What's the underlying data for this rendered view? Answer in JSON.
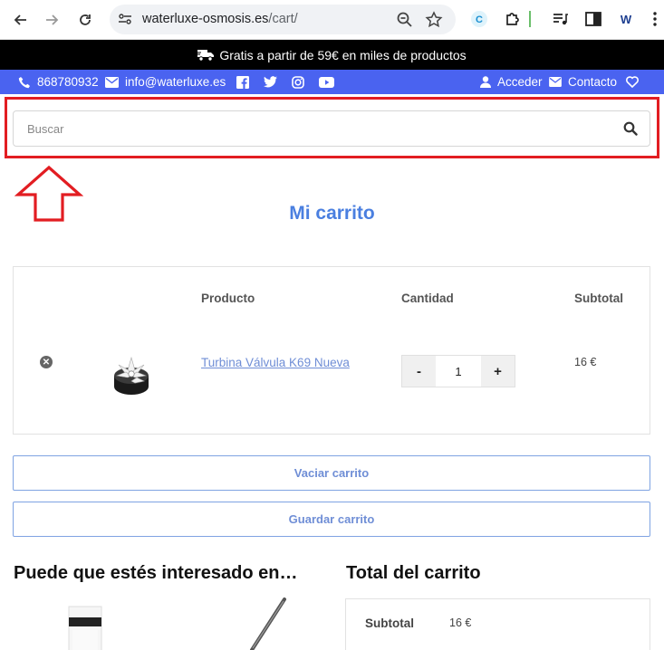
{
  "browser": {
    "url_host": "waterluxe-osmosis.es",
    "url_path": "/cart/",
    "ext_letter": "W"
  },
  "promo": {
    "text": "Gratis a partir de 59€ en miles de productos"
  },
  "topbar": {
    "phone": "868780932",
    "email": "info@waterluxe.es",
    "login": "Acceder",
    "contact": "Contacto",
    "color": "#4a63f0"
  },
  "search": {
    "placeholder": "Buscar"
  },
  "page": {
    "title": "Mi carrito"
  },
  "cart": {
    "headers": {
      "product": "Producto",
      "quantity": "Cantidad",
      "subtotal": "Subtotal"
    },
    "items": [
      {
        "name": "Turbina Válvula K69 Nueva",
        "quantity": "1",
        "subtotal": "16 €"
      }
    ],
    "minus": "-",
    "plus": "+"
  },
  "actions": {
    "empty": "Vaciar carrito",
    "save": "Guardar carrito"
  },
  "related": {
    "title": "Puede que estés interesado en…"
  },
  "totals": {
    "title": "Total del carrito",
    "subtotal_label": "Subtotal",
    "subtotal_value": "16 €"
  },
  "colors": {
    "accent": "#4a7fe0",
    "highlight": "#e21d22"
  }
}
